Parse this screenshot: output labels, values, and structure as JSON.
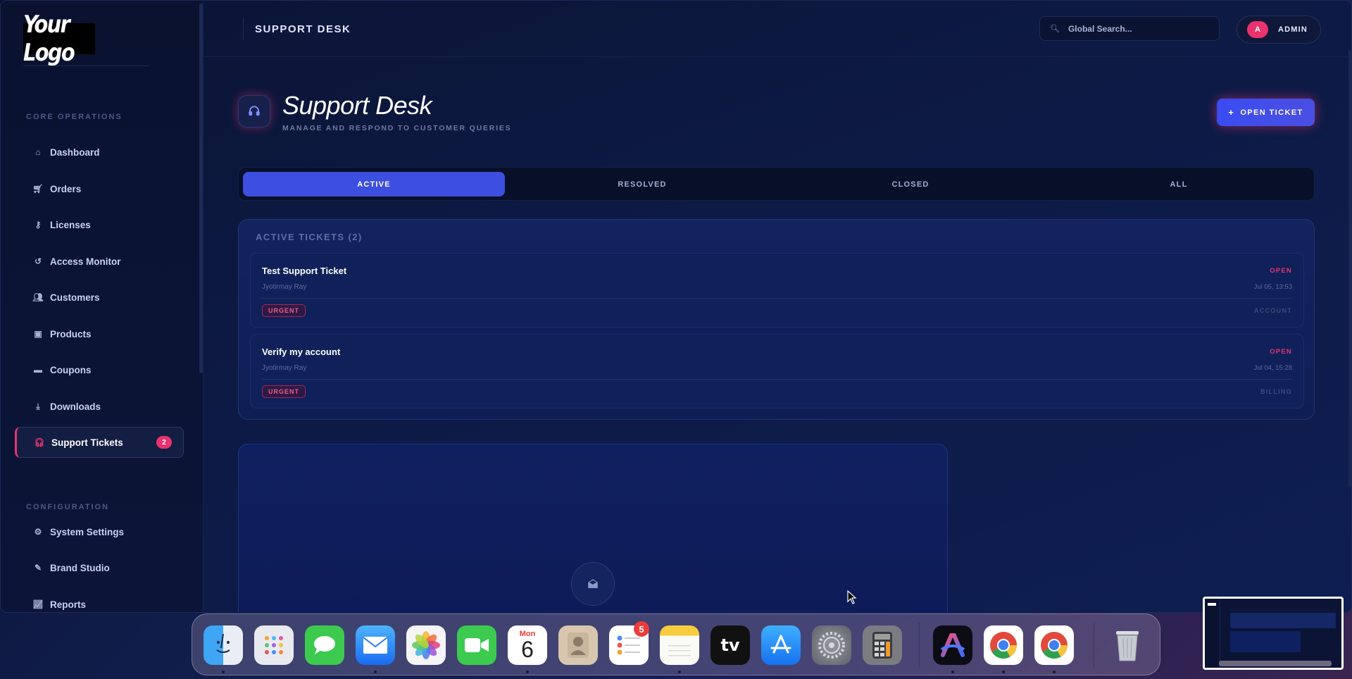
{
  "sidebar": {
    "logo": "Your Logo",
    "section_core": "CORE OPERATIONS",
    "section_config": "CONFIGURATION",
    "items": [
      {
        "label": "Dashboard",
        "icon": "home-icon"
      },
      {
        "label": "Orders",
        "icon": "cart-icon"
      },
      {
        "label": "Licenses",
        "icon": "key-icon"
      },
      {
        "label": "Access Monitor",
        "icon": "history-icon"
      },
      {
        "label": "Customers",
        "icon": "users-icon"
      },
      {
        "label": "Products",
        "icon": "box-icon"
      },
      {
        "label": "Coupons",
        "icon": "ticket-icon"
      },
      {
        "label": "Downloads",
        "icon": "download-icon"
      },
      {
        "label": "Support Tickets",
        "icon": "headset-icon",
        "badge": "2",
        "active": true
      }
    ],
    "config_items": [
      {
        "label": "System Settings",
        "icon": "gear-icon"
      },
      {
        "label": "Brand Studio",
        "icon": "brush-icon"
      },
      {
        "label": "Reports",
        "icon": "chart-line-icon"
      }
    ]
  },
  "header": {
    "title": "SUPPORT DESK",
    "search_placeholder": "Global Search...",
    "avatar_initial": "A",
    "user_label": "ADMIN"
  },
  "page": {
    "title": "Support Desk",
    "subtitle": "MANAGE AND RESPOND TO CUSTOMER QUERIES",
    "open_ticket_label": "OPEN TICKET"
  },
  "tabs": [
    {
      "label": "ACTIVE",
      "active": true
    },
    {
      "label": "RESOLVED"
    },
    {
      "label": "CLOSED"
    },
    {
      "label": "ALL"
    }
  ],
  "tickets_panel": {
    "title": "ACTIVE TICKETS (2)",
    "tickets": [
      {
        "subject": "Test Support Ticket",
        "user": "Jyotirmay Ray",
        "status": "OPEN",
        "date": "Jul 05, 13:53",
        "priority": "URGENT",
        "category": "ACCOUNT"
      },
      {
        "subject": "Verify my account",
        "user": "Jyotirmay Ray",
        "status": "OPEN",
        "date": "Jul 04, 15:28",
        "priority": "URGENT",
        "category": "BILLING"
      }
    ]
  },
  "dock": {
    "apps": [
      "Finder",
      "Launchpad",
      "Messages",
      "Mail",
      "Photos",
      "FaceTime",
      "Calendar",
      "Contacts",
      "Reminders",
      "Notes",
      "TV",
      "App Store",
      "System Settings",
      "Calculator",
      "Arc",
      "Chrome",
      "Chrome",
      "Trash"
    ],
    "calendar_day": "Mon",
    "calendar_date": "6",
    "reminders_badge": "5",
    "tv_label": "tv"
  },
  "colors": {
    "accent": "#3d4fe0",
    "pink": "#e8336f",
    "background": "#0d1a45"
  }
}
